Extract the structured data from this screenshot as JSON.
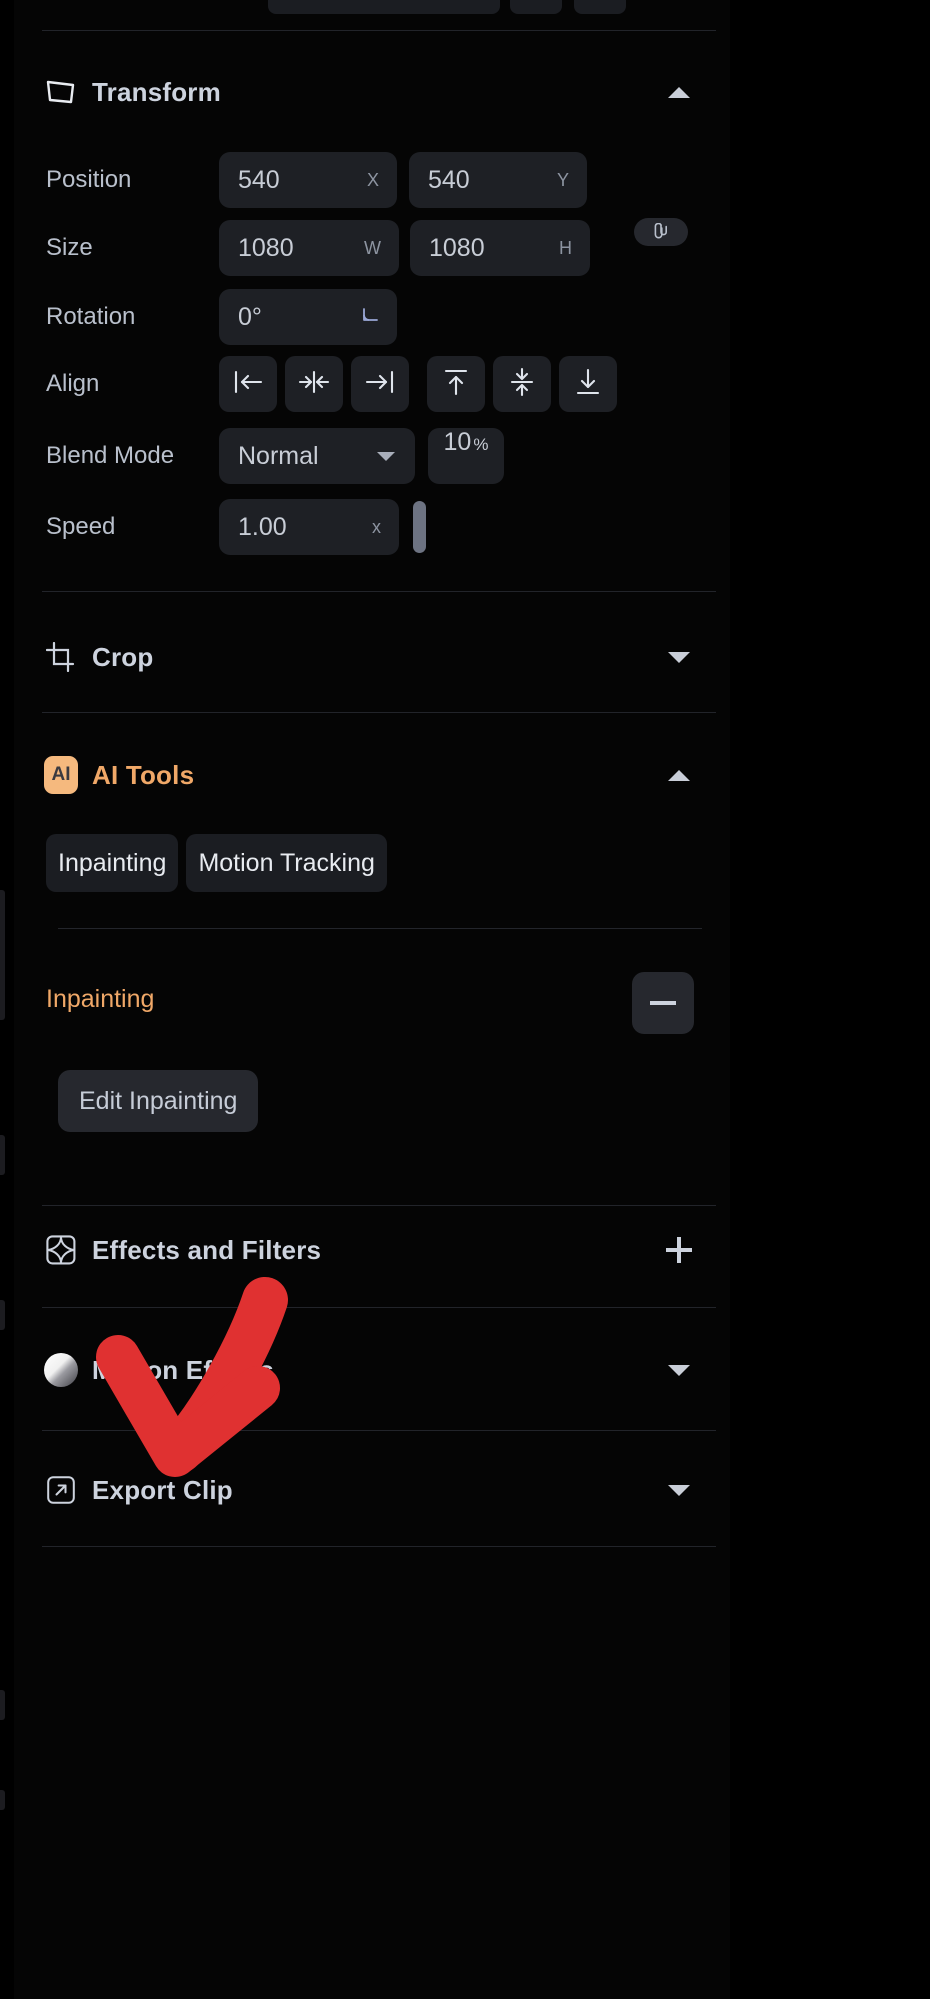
{
  "panel": {
    "background_color": "#050505",
    "accent_color": "#f0a868",
    "annotation_color": "#e03131"
  },
  "sections": {
    "transform": {
      "title": "Transform",
      "icon": "transform-icon",
      "expanded": true,
      "toggle": "collapse-caret-up",
      "rows": {
        "position": {
          "label": "Position",
          "x": {
            "value": "540",
            "unit": "X"
          },
          "y": {
            "value": "540",
            "unit": "Y"
          }
        },
        "size": {
          "label": "Size",
          "w": {
            "value": "1080",
            "unit": "W"
          },
          "h": {
            "value": "1080",
            "unit": "H"
          },
          "link_icon": "link-aspect-ratio-icon"
        },
        "rotation": {
          "label": "Rotation",
          "value": "0°",
          "unit_icon": "angle-icon"
        },
        "align": {
          "label": "Align",
          "buttons": [
            {
              "name": "align-left",
              "icon": "align-left-icon"
            },
            {
              "name": "align-center-horizontal",
              "icon": "align-center-horizontal-icon"
            },
            {
              "name": "align-right",
              "icon": "align-right-icon"
            },
            {
              "name": "align-top",
              "icon": "align-top-icon"
            },
            {
              "name": "align-center-vertical",
              "icon": "align-center-vertical-icon"
            },
            {
              "name": "align-bottom",
              "icon": "align-bottom-icon"
            }
          ]
        },
        "blend_mode": {
          "label": "Blend Mode",
          "value": "Normal",
          "options": [
            "Normal"
          ],
          "opacity": "10",
          "opacity_unit": "%"
        },
        "speed": {
          "label": "Speed",
          "value": "1.00",
          "unit": "x"
        }
      }
    },
    "crop": {
      "title": "Crop",
      "icon": "crop-icon",
      "expanded": false,
      "toggle": "expand-caret-down"
    },
    "ai_tools": {
      "title": "AI Tools",
      "badge": "AI",
      "icon": "ai-badge-icon",
      "expanded": true,
      "toggle": "collapse-caret-up",
      "chips": [
        {
          "label": "Inpainting"
        },
        {
          "label": "Motion Tracking"
        }
      ],
      "active_tool": {
        "label": "Inpainting",
        "remove_icon": "minus-icon",
        "edit_button": "Edit Inpainting"
      }
    },
    "effects_and_filters": {
      "title": "Effects and Filters",
      "icon": "effects-filters-icon",
      "expanded": false,
      "toggle": "add-plus"
    },
    "motion_effects": {
      "title": "Motion Effects",
      "icon": "motion-effects-icon",
      "expanded": false,
      "toggle": "expand-caret-down"
    },
    "export_clip": {
      "title": "Export Clip",
      "icon": "export-external-link-icon",
      "expanded": false,
      "toggle": "expand-caret-down"
    }
  },
  "annotation": {
    "type": "red-arrow",
    "points_to": "Export Clip"
  }
}
